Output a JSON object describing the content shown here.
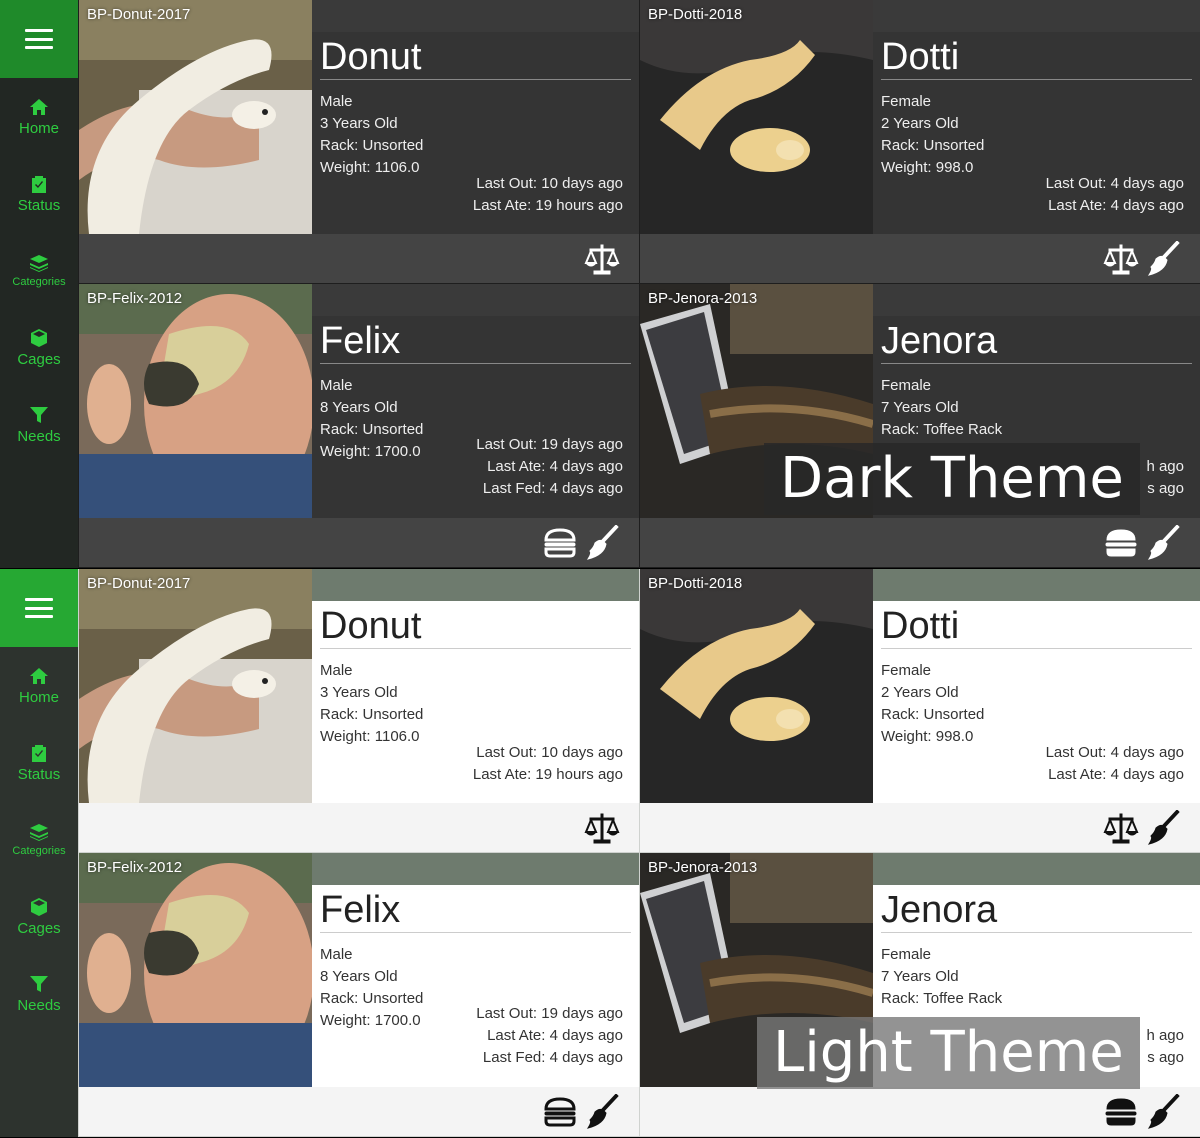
{
  "nav": {
    "items": [
      {
        "label": "Home",
        "icon": "home-icon"
      },
      {
        "label": "Status",
        "icon": "clipboard-check-icon"
      },
      {
        "label": "Categories",
        "icon": "layers-icon"
      },
      {
        "label": "Cages",
        "icon": "cube-icon"
      },
      {
        "label": "Needs",
        "icon": "funnel-icon"
      }
    ]
  },
  "cards": [
    {
      "id": "BP-Donut-2017",
      "name": "Donut",
      "sex": "Male",
      "age": "3 Years Old",
      "rack": "Rack: Unsorted",
      "weight": "Weight: 1106.0",
      "last_out": "Last Out: 10 days ago",
      "last_ate": "Last Ate: 19 hours ago",
      "last_fed": "",
      "actions": [
        "scale-icon"
      ]
    },
    {
      "id": "BP-Dotti-2018",
      "name": "Dotti",
      "sex": "Female",
      "age": "2 Years Old",
      "rack": "Rack: Unsorted",
      "weight": "Weight: 998.0",
      "last_out": "Last Out: 4 days ago",
      "last_ate": "Last Ate: 4 days ago",
      "last_fed": "",
      "actions": [
        "scale-icon",
        "broom-icon"
      ]
    },
    {
      "id": "BP-Felix-2012",
      "name": "Felix",
      "sex": "Male",
      "age": "8 Years Old",
      "rack": "Rack: Unsorted",
      "weight": "Weight: 1700.0",
      "last_out": "Last Out: 19 days ago",
      "last_ate": "Last Ate: 4 days ago",
      "last_fed": "Last Fed: 4 days ago",
      "actions": [
        "burger-icon",
        "broom-icon"
      ]
    },
    {
      "id": "BP-Jenora-2013",
      "name": "Jenora",
      "sex": "Female",
      "age": "7 Years Old",
      "rack": "Rack: Toffee Rack",
      "weight": "",
      "last_out": "",
      "last_ate": "h ago",
      "last_fed": "s ago",
      "actions": [
        "burger-icon",
        "broom-icon"
      ]
    }
  ],
  "labels": {
    "dark": "Dark Theme",
    "light": "Light Theme"
  },
  "colors": {
    "accent": "#2ecc40",
    "menu_dark": "#1f8a2a",
    "menu_light": "#26a833"
  }
}
